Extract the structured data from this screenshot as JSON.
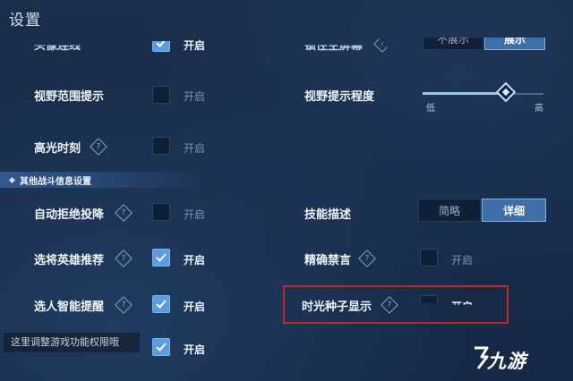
{
  "header": {
    "title": "设置"
  },
  "rows": {
    "r0_left": {
      "label": "头像连线",
      "checked": true,
      "state_label": "开启"
    },
    "r0_right": {
      "label": "锁住主屏幕"
    },
    "display_toggle": {
      "options": [
        "不展示",
        "展示"
      ],
      "selected": "展示"
    },
    "vision_range": {
      "label": "视野范围提示",
      "checked": false,
      "state_label": "开启"
    },
    "vision_level": {
      "label": "视野提示程度",
      "low_label": "低",
      "high_label": "高",
      "value_fraction": 0.7
    },
    "highlight_moment": {
      "label": "高光时刻",
      "checked": false,
      "state_label": "开启"
    }
  },
  "section": {
    "title": "其他战斗信息设置"
  },
  "battle": {
    "auto_refuse": {
      "label": "自动拒绝投降",
      "checked": false,
      "state_label": "开启"
    },
    "skill_desc": {
      "label": "技能描述",
      "options": [
        "简略",
        "详细"
      ],
      "selected": "详细"
    },
    "hero_recommend": {
      "label": "选将英雄推荐",
      "checked": true,
      "state_label": "开启"
    },
    "precise_mute": {
      "label": "精确禁言",
      "checked": false,
      "state_label": "开启"
    },
    "smart_remind": {
      "label": "选人智能提醒",
      "checked": true,
      "state_label": "开启"
    },
    "time_seed": {
      "label": "时光种子显示",
      "checked": false,
      "state_label": "开启"
    },
    "last_row": {
      "checked": true,
      "state_label": "开启"
    }
  },
  "tooltip": {
    "text": "这里调整游戏功能权限哦"
  },
  "watermark": {
    "text": "九游"
  },
  "colors": {
    "highlight_border": "#c0262a",
    "checkbox_on": "#5a9de0",
    "background": "#182c4a"
  },
  "icons": {
    "check": "check-icon",
    "info": "info-diamond-icon",
    "slider_thumb": "diamond-thumb"
  }
}
